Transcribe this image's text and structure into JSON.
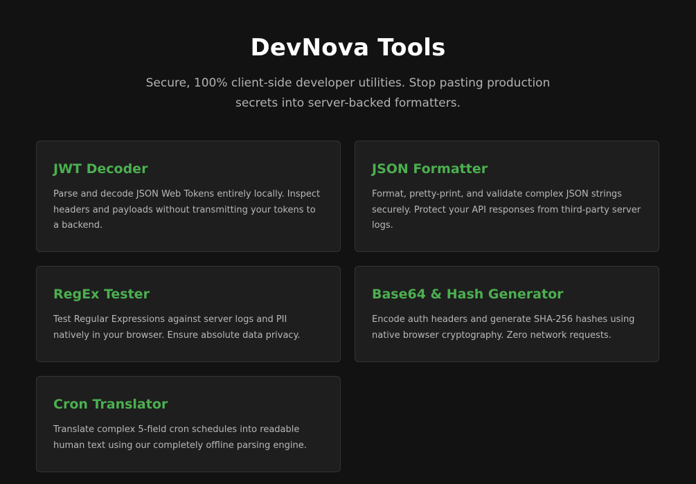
{
  "header": {
    "title": "DevNova Tools",
    "subtitle": "Secure, 100% client-side developer utilities. Stop pasting production secrets into server-backed formatters."
  },
  "tools": [
    {
      "title": "JWT Decoder",
      "description": "Parse and decode JSON Web Tokens entirely locally. Inspect headers and payloads without transmitting your tokens to a backend."
    },
    {
      "title": "JSON Formatter",
      "description": "Format, pretty-print, and validate complex JSON strings securely. Protect your API responses from third-party server logs."
    },
    {
      "title": "RegEx Tester",
      "description": "Test Regular Expressions against server logs and PII natively in your browser. Ensure absolute data privacy."
    },
    {
      "title": "Base64 & Hash Generator",
      "description": "Encode auth headers and generate SHA-256 hashes using native browser cryptography. Zero network requests."
    },
    {
      "title": "Cron Translator",
      "description": "Translate complex 5-field cron schedules into readable human text using our completely offline parsing engine."
    }
  ],
  "colors": {
    "background": "#121212",
    "card_background": "#1e1e1e",
    "card_border": "#333333",
    "accent": "#4caf50",
    "title": "#ffffff",
    "text_muted": "#b3b3b3"
  }
}
